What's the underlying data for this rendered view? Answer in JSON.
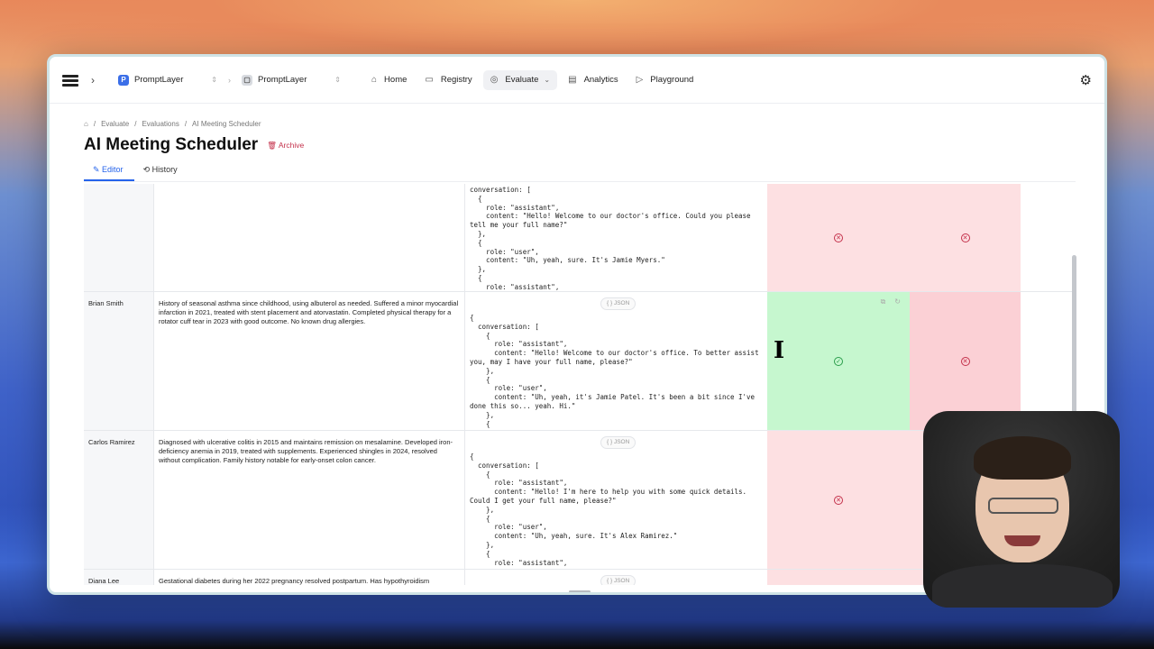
{
  "topbar": {
    "workspace1": {
      "badge": "P",
      "label": "PromptLayer"
    },
    "workspace2": {
      "label": "PromptLayer"
    },
    "nav": [
      {
        "label": "Home",
        "icon": "home-icon"
      },
      {
        "label": "Registry",
        "icon": "folder-icon"
      },
      {
        "label": "Evaluate",
        "icon": "evaluate-icon",
        "active": true
      },
      {
        "label": "Analytics",
        "icon": "analytics-icon"
      },
      {
        "label": "Playground",
        "icon": "play-icon"
      }
    ]
  },
  "breadcrumb": [
    "Evaluate",
    "Evaluations",
    "AI Meeting Scheduler"
  ],
  "page": {
    "title": "AI Meeting Scheduler",
    "archive_label": "Archive"
  },
  "tabs": [
    {
      "label": "Editor",
      "active": true
    },
    {
      "label": "History",
      "active": false
    }
  ],
  "json_label": "{ } JSON",
  "rows": [
    {
      "name": "",
      "history": "",
      "conversation": "conversation: [\n  {\n    role: \"assistant\",\n    content: \"Hello! Welcome to our doctor's office. Could you please\ntell me your full name?\"\n  },\n  {\n    role: \"user\",\n    content: \"Uh, yeah, sure. It's Jamie Myers.\"\n  },\n  {\n    role: \"assistant\",",
      "eval1": "fail",
      "eval2": "fail"
    },
    {
      "name": "Brian Smith",
      "history": "History of seasonal asthma since childhood, using albuterol as needed. Suffered a minor myocardial infarction in 2021, treated with stent placement and atorvastatin. Completed physical therapy for a rotator cuff tear in 2023 with good outcome. No known drug allergies.",
      "conversation": "{\n  conversation: [\n    {\n      role: \"assistant\",\n      content: \"Hello! Welcome to our doctor's office. To better assist\nyou, may I have your full name, please?\"\n    },\n    {\n      role: \"user\",\n      content: \"Uh, yeah, it's Jamie Patel. It's been a bit since I've\ndone this so... yeah. Hi.\"\n    },\n    {",
      "eval1": "pass",
      "eval2": "fail"
    },
    {
      "name": "Carlos Ramirez",
      "history": "Diagnosed with ulcerative colitis in 2015 and maintains remission on mesalamine. Developed iron-deficiency anemia in 2019, treated with supplements. Experienced shingles in 2024, resolved without complication. Family history notable for early-onset colon cancer.",
      "conversation": "{\n  conversation: [\n    {\n      role: \"assistant\",\n      content: \"Hello! I'm here to help you with some quick details.\nCould I get your full name, please?\"\n    },\n    {\n      role: \"user\",\n      content: \"Uh, yeah, sure. It's Alex Ramirez.\"\n    },\n    {\n      role: \"assistant\",",
      "eval1": "fail",
      "eval2": "fail"
    },
    {
      "name": "Diana Lee",
      "history": "Gestational diabetes during her 2022 pregnancy resolved postpartum. Has hypothyroidism",
      "conversation": "",
      "eval1": "fail",
      "eval2": "fail"
    }
  ],
  "colors": {
    "accent": "#2563eb",
    "fail_bg": "#fde0e2",
    "pass_bg": "#c6f7cf",
    "archive": "#c4314b"
  }
}
